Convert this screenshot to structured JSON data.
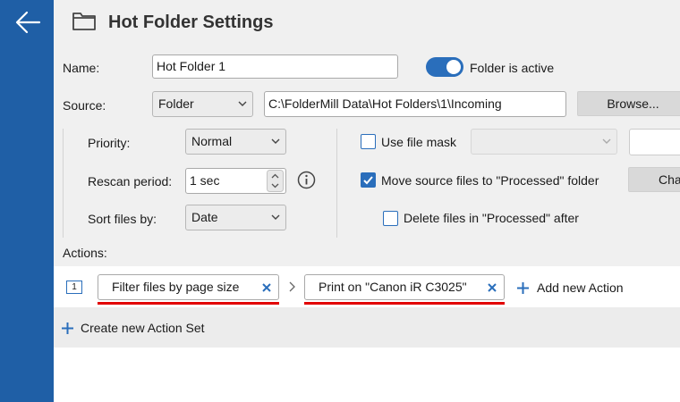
{
  "header": {
    "title": "Hot Folder Settings",
    "back_icon": "arrow-left-icon",
    "folder_icon": "folder-icon"
  },
  "form": {
    "name_label": "Name:",
    "name_value": "Hot Folder 1",
    "active_label": "Folder is active",
    "active_on": true,
    "source_label": "Source:",
    "source_type": "Folder",
    "source_path": "C:\\FolderMill Data\\Hot Folders\\1\\Incoming",
    "browse_label": "Browse...",
    "priority_label": "Priority:",
    "priority_value": "Normal",
    "rescan_label": "Rescan period:",
    "rescan_value": "1 sec",
    "sort_label": "Sort files by:",
    "sort_value": "Date",
    "file_mask_label": "Use file mask",
    "file_mask_checked": false,
    "move_label": "Move source files to \"Processed\" folder",
    "move_checked": true,
    "change_label": "Cha",
    "delete_label": "Delete files in \"Processed\" after",
    "delete_checked": false,
    "actions_label": "Actions:"
  },
  "actions": {
    "set_number": "1",
    "items": [
      {
        "label": "Filter files by page size"
      },
      {
        "label": "Print on \"Canon iR C3025\""
      }
    ],
    "add_action_label": "Add new Action",
    "new_set_label": "Create new Action Set"
  },
  "colors": {
    "sidebar": "#1f5fa6",
    "accent": "#2a6ebb",
    "underline": "#e10000",
    "panel": "#f0f0f0"
  }
}
